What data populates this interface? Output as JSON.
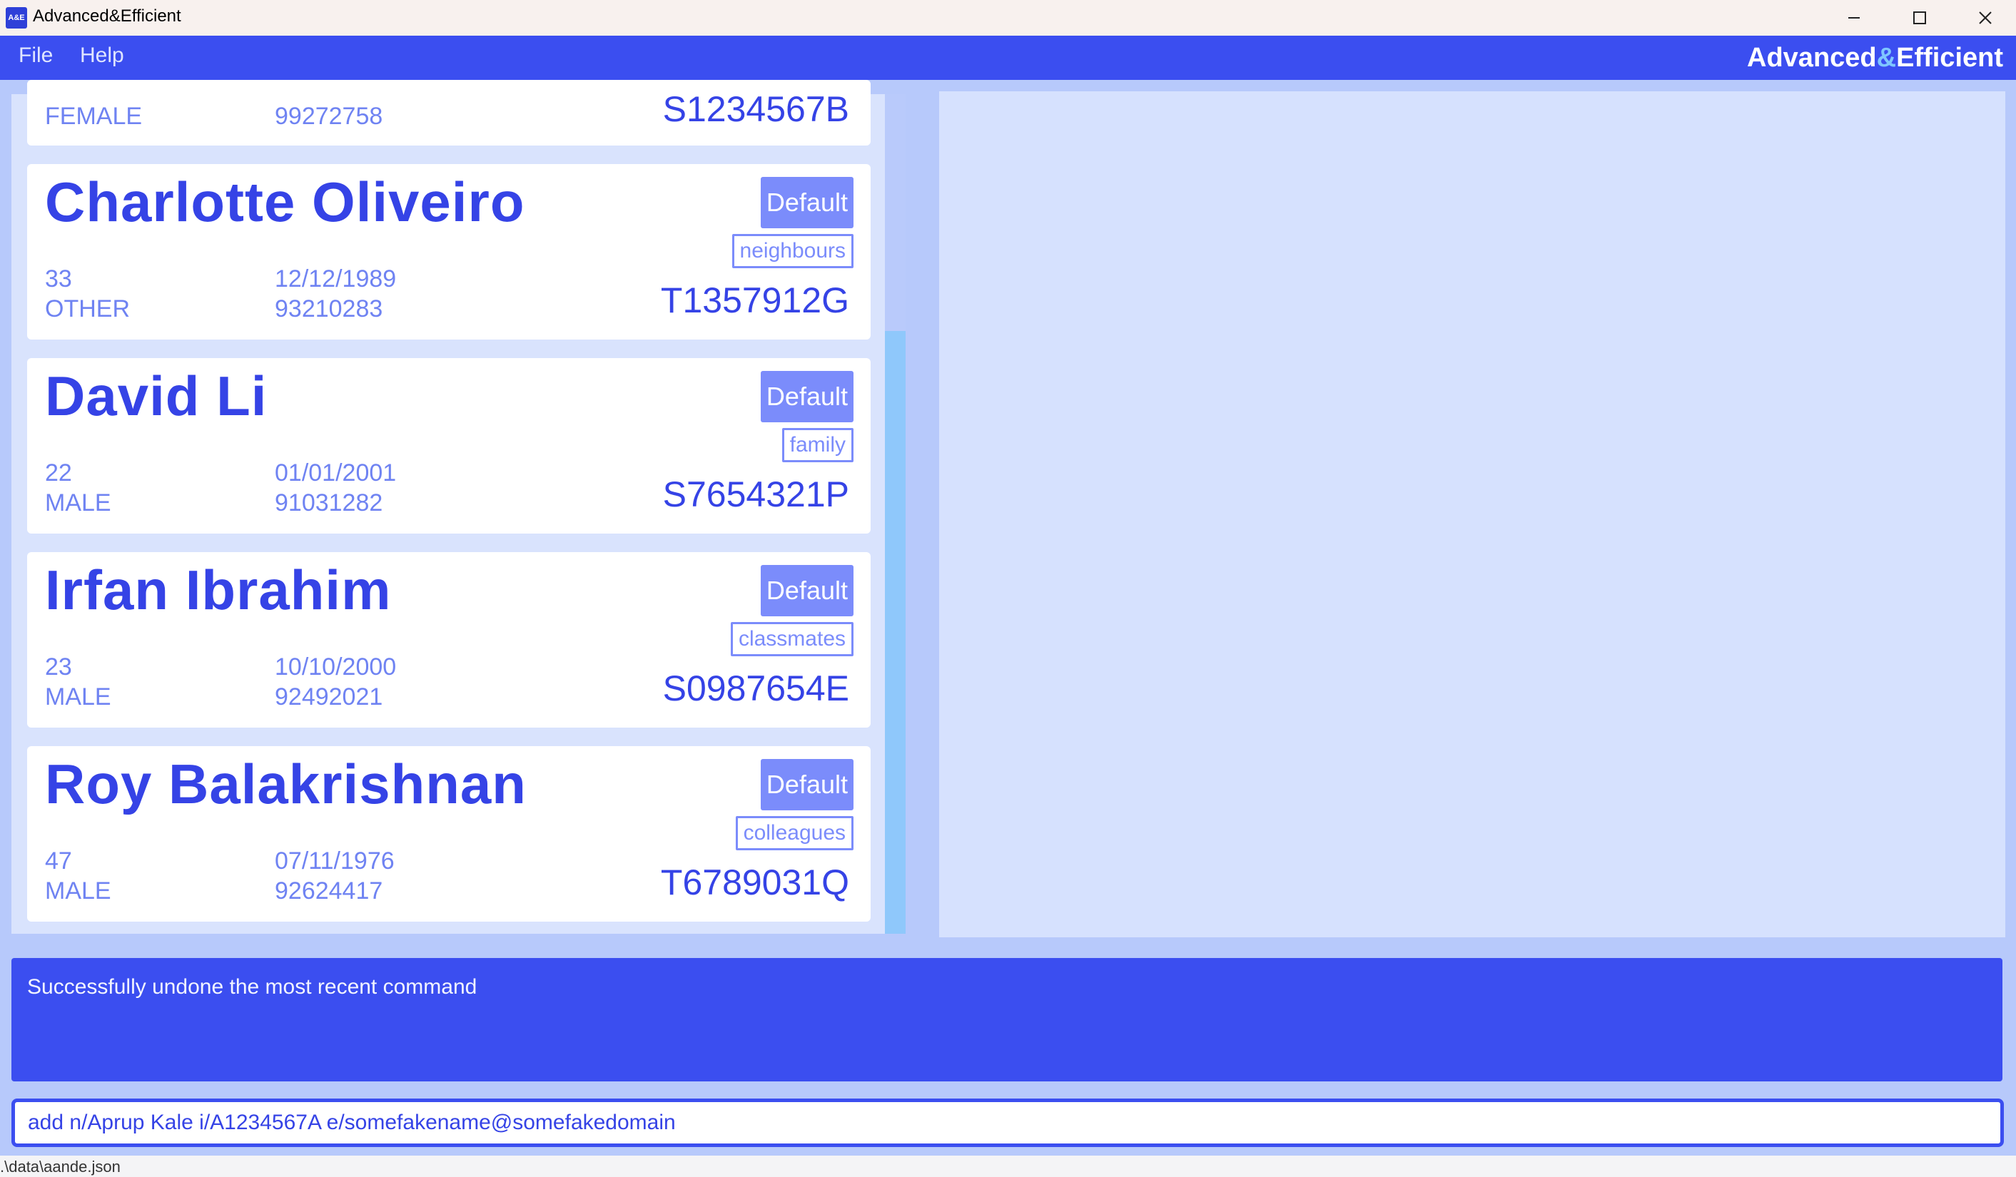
{
  "window": {
    "title": "Advanced&Efficient",
    "icon_text": "A&E"
  },
  "menu": {
    "file": "File",
    "help": "Help"
  },
  "brand": {
    "left": "Advanced",
    "amp": "&",
    "right": "Efficient"
  },
  "persons": [
    {
      "gender": "FEMALE",
      "phone": "99272758",
      "nric": "S1234567B"
    },
    {
      "name": "Charlotte Oliveiro",
      "group": "Default",
      "tag": "neighbours",
      "age": "33",
      "gender": "OTHER",
      "birthday": "12/12/1989",
      "phone": "93210283",
      "nric": "T1357912G"
    },
    {
      "name": "David Li",
      "group": "Default",
      "tag": "family",
      "age": "22",
      "gender": "MALE",
      "birthday": "01/01/2001",
      "phone": "91031282",
      "nric": "S7654321P"
    },
    {
      "name": "Irfan Ibrahim",
      "group": "Default",
      "tag": "classmates",
      "age": "23",
      "gender": "MALE",
      "birthday": "10/10/2000",
      "phone": "92492021",
      "nric": "S0987654E"
    },
    {
      "name": "Roy Balakrishnan",
      "group": "Default",
      "tag": "colleagues",
      "age": "47",
      "gender": "MALE",
      "birthday": "07/11/1976",
      "phone": "92624417",
      "nric": "T6789031Q"
    }
  ],
  "result": "Successfully undone the most recent command",
  "command": "add n/Aprup Kale i/A1234567A e/somefakename@somefakedomain",
  "status": {
    "path": ".\\data\\aande.json"
  },
  "colors": {
    "primary": "#3b4ef0",
    "accent": "#7b8cfb",
    "background": "#b7c9fb",
    "scroll_thumb": "#8fc8fb"
  },
  "icons": {
    "minimize": "minimize-icon",
    "maximize": "maximize-icon",
    "close": "close-icon"
  }
}
